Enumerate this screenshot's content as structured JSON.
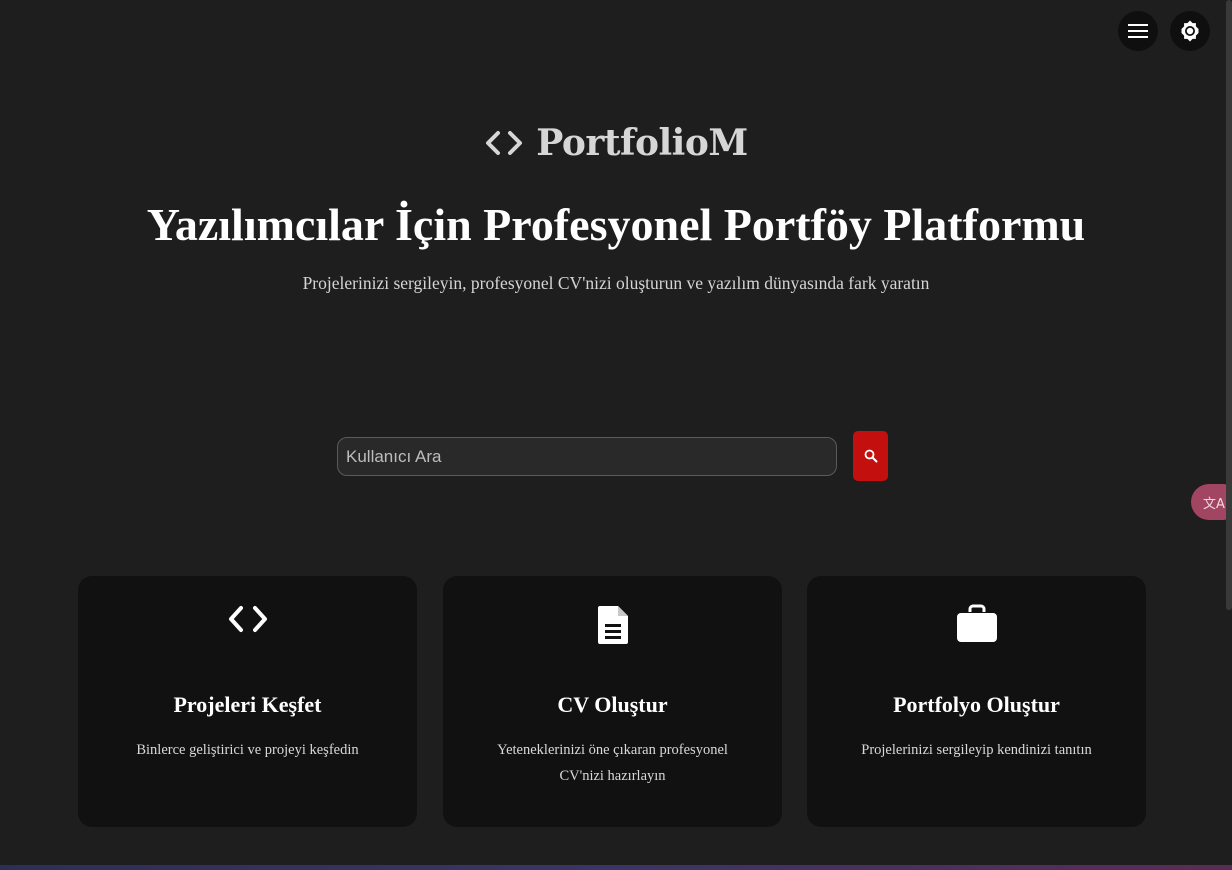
{
  "header": {
    "menu_icon": "menu-icon",
    "theme_icon": "brightness-icon"
  },
  "brand": {
    "icon": "code-icon",
    "name": "PortfolioM"
  },
  "hero": {
    "title": "Yazılımcılar İçin Profesyonel Portföy Platformu",
    "subtitle": "Projelerinizi sergileyin, profesyonel CV'nizi oluşturun ve yazılım dünyasında fark yaratın"
  },
  "search": {
    "placeholder": "Kullanıcı Ara",
    "value": "",
    "button_icon": "search-icon"
  },
  "translate_fab": {
    "icon": "translate-icon"
  },
  "cards": [
    {
      "icon": "code-icon",
      "title": "Projeleri Keşfet",
      "description": "Binlerce geliştirici ve projeyi keşfedin"
    },
    {
      "icon": "document-icon",
      "title": "CV Oluştur",
      "description": "Yeteneklerinizi öne çıkaran profesyonel CV'nizi hazırlayın"
    },
    {
      "icon": "briefcase-icon",
      "title": "Portfolyo Oluştur",
      "description": "Projelerinizi sergileyip kendinizi tanıtın"
    }
  ],
  "colors": {
    "background": "#1f1e1f",
    "card_background": "#111111",
    "accent_red": "#c40f0f",
    "translate_pink": "#a24562"
  }
}
